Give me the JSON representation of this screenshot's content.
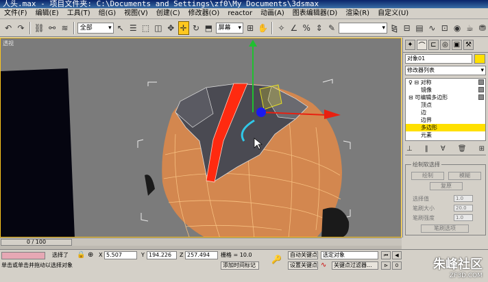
{
  "window": {
    "title": "人头.max    - 项目文件夹: C:\\Documents and Settings\\zf0\\My Documents\\3dsmax"
  },
  "menu": [
    "文件(F)",
    "编辑(E)",
    "工具(T)",
    "组(G)",
    "视图(V)",
    "创建(C)",
    "修改器(O)",
    "reactor",
    "动画(A)",
    "图表编辑器(D)",
    "渲染(R)",
    "自定义(U)"
  ],
  "toolbar": {
    "selection_filter": "全部",
    "ref_coord": "屏幕"
  },
  "viewport": {
    "label": "透视"
  },
  "command_panel": {
    "object_name": "对象01",
    "modifier_list": "修改器列表",
    "stack": [
      {
        "label": "♀ ⊟ 对称",
        "indent": 0,
        "selected": false,
        "box": true
      },
      {
        "label": "镜像",
        "indent": 1,
        "selected": false,
        "box": true
      },
      {
        "label": "⊟ 可编辑多边形",
        "indent": 0,
        "selected": false,
        "box": true
      },
      {
        "label": "顶点",
        "indent": 1,
        "selected": false,
        "box": false
      },
      {
        "label": "边",
        "indent": 1,
        "selected": false,
        "box": false
      },
      {
        "label": "边界",
        "indent": 1,
        "selected": false,
        "box": false
      },
      {
        "label": "多边形",
        "indent": 1,
        "selected": true,
        "box": false
      },
      {
        "label": "元素",
        "indent": 1,
        "selected": false,
        "box": false
      }
    ],
    "rollout": {
      "title": "绘制软选择",
      "paint_btn": "绘制",
      "blur_btn": "模糊",
      "revert_btn": "复原",
      "select_value_label": "选择值",
      "select_value": "1.0",
      "brush_size_label": "笔刷大小",
      "brush_size": "20.0",
      "brush_strength_label": "笔刷强度",
      "brush_strength": "1.0",
      "brush_options_btn": "笔刷选项"
    }
  },
  "timeline": {
    "frame": "0 / 100"
  },
  "status": {
    "selected_label": "选择了",
    "prompt": "单击或单击并拖动以选择对象",
    "x_label": "X",
    "x": "5.507",
    "y_label": "Y",
    "y": "194.226",
    "z_label": "Z",
    "z": "257.494",
    "grid": "栅格 = 10.0",
    "add_time_tag": "添加时间标记",
    "auto_key": "自动关键点",
    "set_key": "设置关键点",
    "selected_objects": "选定对象",
    "key_filters": "关键点过滤器..."
  },
  "watermark": {
    "main": "朱峰社区",
    "sub": "ZF3D.COM"
  }
}
